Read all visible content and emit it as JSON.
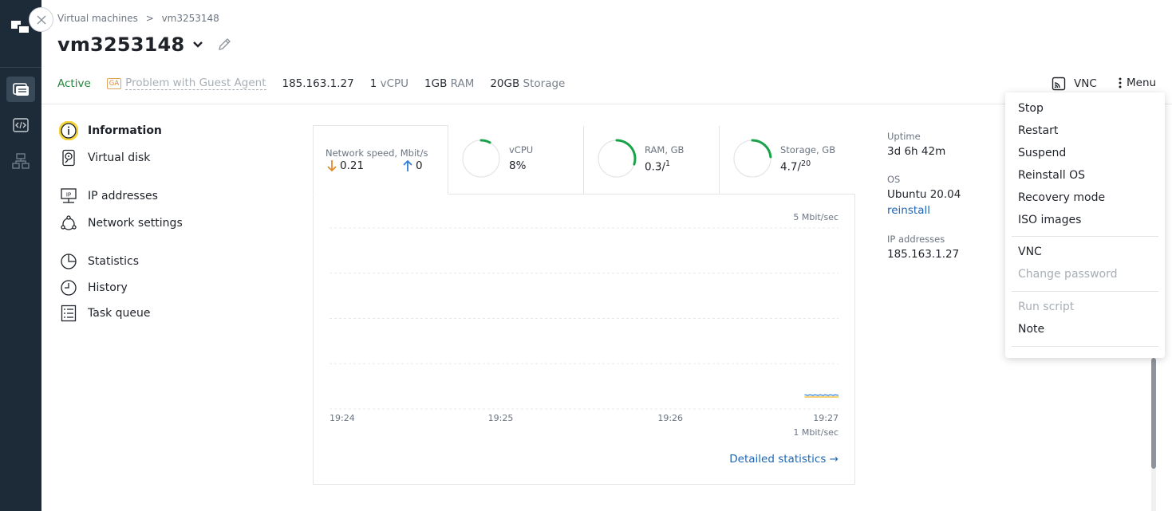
{
  "breadcrumb": {
    "root": "Virtual machines",
    "sep": ">",
    "current": "vm3253148"
  },
  "vm": {
    "name": "vm3253148"
  },
  "status": {
    "state": "Active",
    "ga_badge": "GA",
    "ga_text": "Problem with Guest Agent",
    "ip": "185.163.1.27",
    "cpu_num": "1",
    "cpu_unit": "vCPU",
    "ram_num": "1GB",
    "ram_unit": "RAM",
    "storage_num": "20GB",
    "storage_unit": "Storage"
  },
  "toolbar": {
    "vnc": "VNC",
    "menu": "Menu"
  },
  "nav": {
    "items": [
      {
        "label": "Information",
        "icon": "info-icon",
        "active": true
      },
      {
        "label": "Virtual disk",
        "icon": "disk-icon"
      },
      {
        "label": "IP addresses",
        "icon": "ip-icon"
      },
      {
        "label": "Network settings",
        "icon": "network-icon"
      },
      {
        "label": "Statistics",
        "icon": "pie-chart-icon"
      },
      {
        "label": "History",
        "icon": "clock-icon"
      },
      {
        "label": "Task queue",
        "icon": "list-icon"
      }
    ]
  },
  "tabs": {
    "network": {
      "title": "Network speed, Mbit/s",
      "down": "0.21",
      "up": "0"
    },
    "cpu": {
      "title": "vCPU",
      "value": "8%",
      "fraction": 0.08
    },
    "ram": {
      "title": "RAM, GB",
      "value": "0.3/",
      "total": "1",
      "fraction": 0.3
    },
    "storage": {
      "title": "Storage, GB",
      "value": "4.7/",
      "total": "20",
      "fraction": 0.235
    }
  },
  "chart_data": {
    "type": "line",
    "x": [
      "19:24",
      "19:25",
      "19:26",
      "19:27"
    ],
    "y_top_label": "5 Mbit/sec",
    "y_bottom_label": "1 Mbit/sec",
    "series": [
      {
        "color": "#4a90e2",
        "values": [
          null,
          null,
          null,
          0.21
        ]
      },
      {
        "color": "#f5c242",
        "values": [
          null,
          null,
          null,
          0
        ]
      }
    ]
  },
  "detailed_link": "Detailed statistics →",
  "info": {
    "uptime_label": "Uptime",
    "uptime": "3d 6h 42m",
    "os_label": "OS",
    "os": "Ubuntu 20.04",
    "reinstall": "reinstall",
    "ip_label": "IP addresses",
    "ip": "185.163.1.27"
  },
  "menu": {
    "group1": [
      "Stop",
      "Restart",
      "Suspend",
      "Reinstall OS",
      "Recovery mode",
      "ISO images"
    ],
    "group2": [
      "VNC",
      "Change password"
    ],
    "group3": [
      "Run script",
      "Note"
    ]
  },
  "colors": {
    "rail": "#1d2a37",
    "active": "#23873e",
    "link": "#1d65b3",
    "gauge": "#1aa24a",
    "down_arrow": "#e58a2c",
    "up_arrow": "#2f7fd9"
  }
}
